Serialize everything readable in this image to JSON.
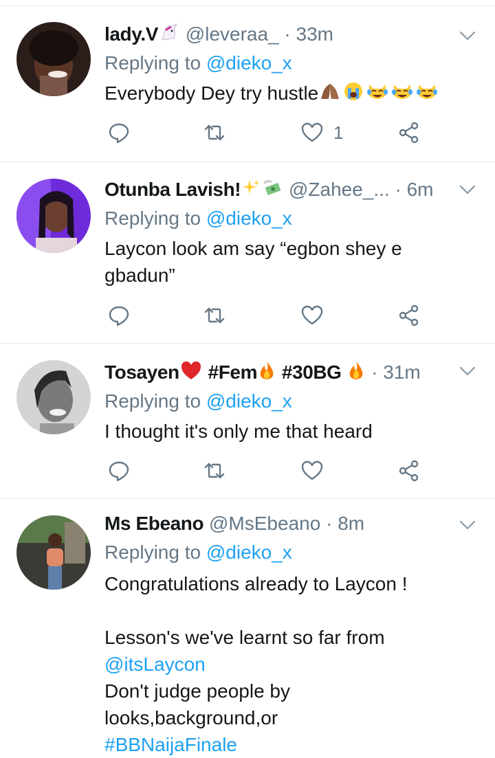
{
  "colors": {
    "link": "#1da1f2",
    "muted": "#657786",
    "text": "#14171a",
    "divider": "#e1e8ed"
  },
  "tweets": [
    {
      "name": "lady.V",
      "name_emoji": "unicorn-icon",
      "handle": "@leveraa_",
      "dot": "·",
      "time": "33m",
      "replying_prefix": "Replying to",
      "replying_handle": "@dieko_x",
      "body": "Everybody Dey try hustle",
      "body_emojis": [
        "praying-hands-icon",
        "loudly-crying-face-icon",
        "cat-tears-of-joy-icon",
        "cat-tears-of-joy-icon",
        "cat-tears-of-joy-icon"
      ],
      "likes": "1"
    },
    {
      "name": "Otunba Lavish!",
      "name_emojis": [
        "sparkles-icon",
        "money-with-wings-icon"
      ],
      "handle": "@Zahee_...",
      "dot": "·",
      "time": "6m",
      "replying_prefix": "Replying to",
      "replying_handle": "@dieko_x",
      "body_line1": "Laycon look am say “egbon shey e",
      "body_line2": "gbadun”"
    },
    {
      "name": "Tosayen",
      "name_emoji": "red-heart-icon",
      "name_tag1": "#Fem",
      "name_tag2": "#30BG",
      "name_emojis": [
        "fire-icon",
        "fire-icon"
      ],
      "dot": "·",
      "time": "31m",
      "replying_prefix": "Replying to",
      "replying_handle": "@dieko_x",
      "body": "I thought it's only me that heard"
    },
    {
      "name": "Ms Ebeano",
      "handle": "@MsEbeano",
      "dot": "·",
      "time": "8m",
      "replying_prefix": "Replying to",
      "replying_handle": "@dieko_x",
      "body_line1": "Congratulations already to Laycon !",
      "body_line2": "Lesson's we've learnt so far from",
      "body_mention": "@itsLaycon",
      "body_line3": "Don't judge people by",
      "body_line4": "looks,background,or",
      "body_hashtag": "#BBNaijaFinale"
    }
  ]
}
